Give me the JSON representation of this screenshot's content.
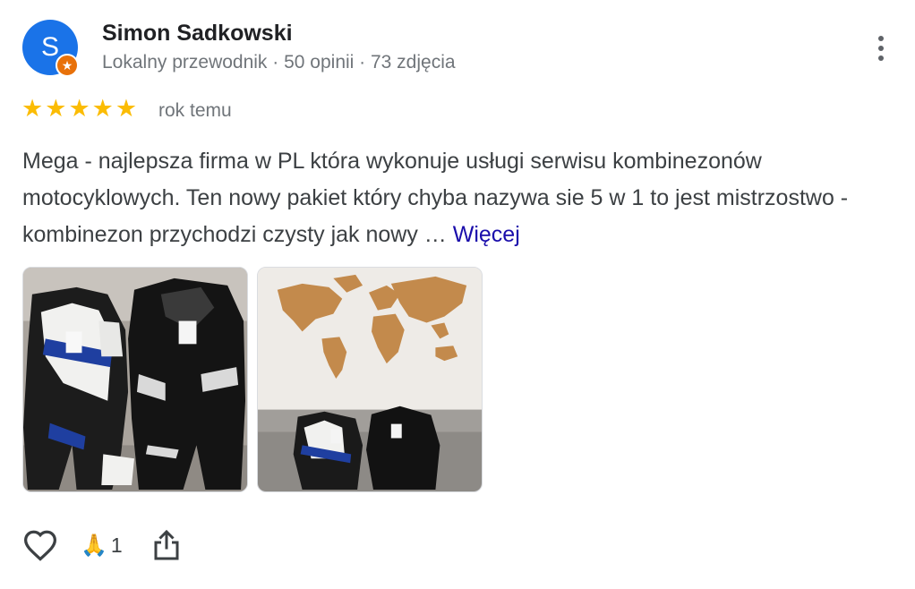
{
  "reviewer": {
    "initial": "S",
    "name": "Simon Sadkowski",
    "meta": "Lokalny przewodnik · 50 opinii · 73 zdjęcia",
    "avatar_color": "#1a73e8",
    "badge_color": "#e8710a"
  },
  "rating": {
    "stars": 5,
    "max": 5,
    "time": "rok temu",
    "star_color": "#fbbc04"
  },
  "review": {
    "text": "Mega - najlepsza firma w PL która wykonuje usługi serwisu kombinezonów motocyklowych. Ten nowy pakiet który chyba nazywa sie 5 w 1 to jest mistrzostwo - kombinezon przychodzi czysty jak nowy … ",
    "more_label": "Więcej",
    "link_color": "#1a0dab"
  },
  "photos": [
    "motorcycle-suits-photo",
    "world-map-wall-photo"
  ],
  "actions": {
    "like_icon": "heart-outline-icon",
    "reaction_emoji": "🙏",
    "reaction_count": "1",
    "share_icon": "share-icon"
  },
  "menu_icon": "more-vert-icon"
}
